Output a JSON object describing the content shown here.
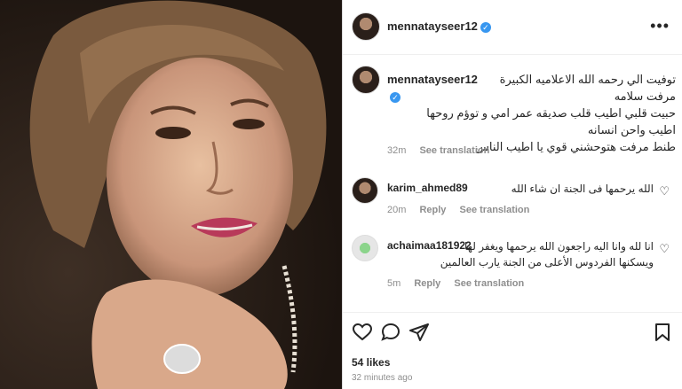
{
  "post": {
    "author": "mennatayseer12",
    "verified_mark": "✓",
    "caption_lines": [
      "توفيت الي رحمه الله الاعلاميه الكبيرة مرفت سلامه",
      "حبيت قلبي اطيب قلب صديقه عمر امي و توؤم روحها",
      "اطيب واحن انسانه",
      "طنط مرفت هتوحشني قوي يا اطيب الناس"
    ],
    "caption_age": "32m",
    "see_translation": "See translation",
    "likes": "54 likes",
    "posted_ago": "32 minutes ago"
  },
  "comments": [
    {
      "user": "karim_ahmed89",
      "text": "الله يرحمها فى الجنة ان شاء الله",
      "age": "20m",
      "reply": "Reply",
      "see_translation": "See translation"
    },
    {
      "user": "achaimaa181922",
      "text_lines": [
        "انا لله وانا اليه راجعون الله يرحمها ويغفر لها",
        "ويسكنها الفردوس الأعلى من الجنة يارب العالمين"
      ],
      "age": "5m",
      "reply": "Reply",
      "see_translation": "See translation"
    }
  ],
  "icons": {
    "more": "more-options-icon",
    "like": "heart-icon",
    "comment": "comment-icon",
    "share": "share-icon",
    "save": "bookmark-icon"
  },
  "colors": {
    "verified": "#3897f0",
    "meta_gray": "#8e8e8e",
    "text": "#262626"
  }
}
